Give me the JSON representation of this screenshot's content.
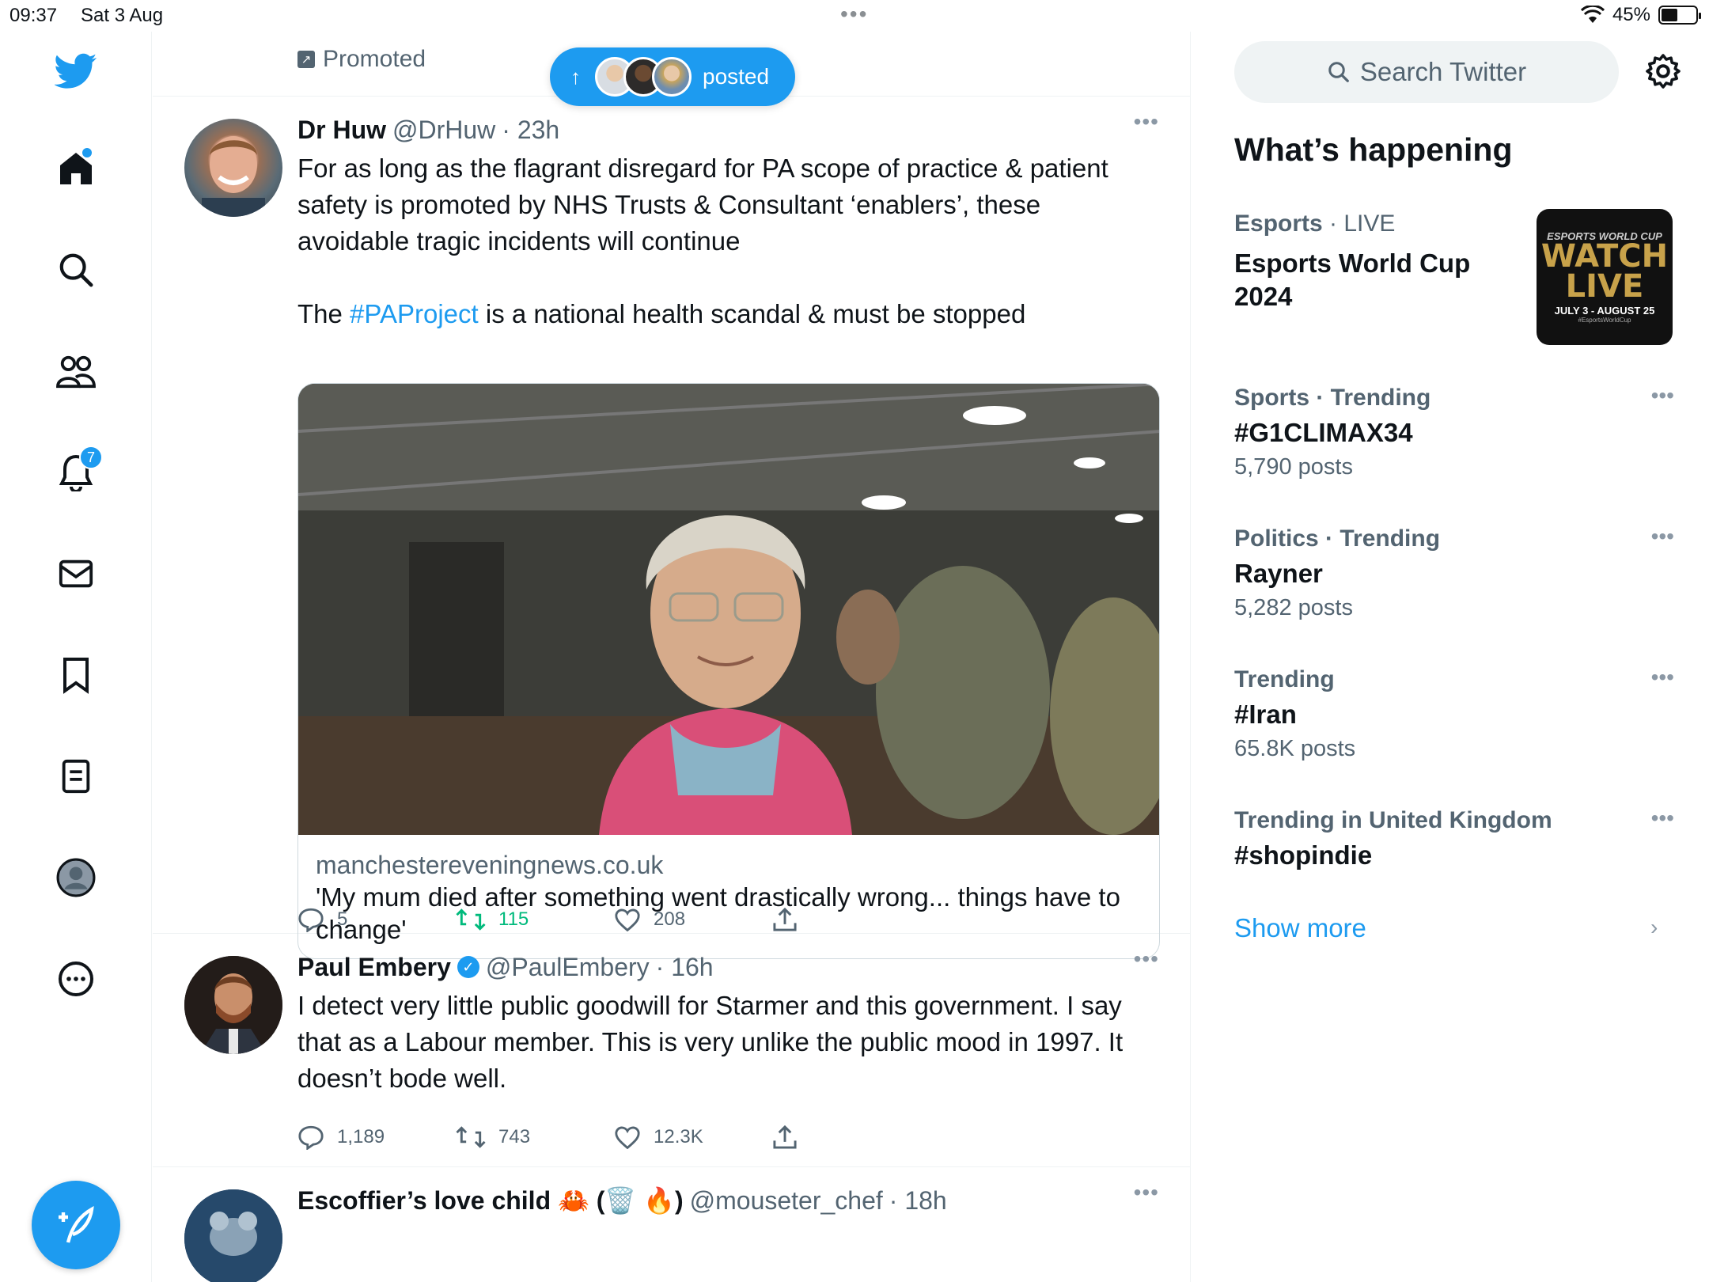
{
  "status_bar": {
    "time": "09:37",
    "date": "Sat 3 Aug",
    "battery": "45%"
  },
  "colors": {
    "accent": "#1d9bf0",
    "retweet": "#00ba7c",
    "secondary_text": "#536471"
  },
  "nav": {
    "items": [
      {
        "name": "twitter-logo-icon"
      },
      {
        "name": "home-icon"
      },
      {
        "name": "explore-icon"
      },
      {
        "name": "communities-icon"
      },
      {
        "name": "notifications-icon",
        "badge": "7"
      },
      {
        "name": "messages-icon"
      },
      {
        "name": "bookmarks-icon"
      },
      {
        "name": "lists-icon"
      },
      {
        "name": "profile-icon"
      },
      {
        "name": "more-icon"
      }
    ],
    "compose": "compose-icon"
  },
  "timeline": {
    "promoted_label": "Promoted",
    "new_posts_pill": {
      "label": "posted"
    },
    "tweets": [
      {
        "name": "Dr Huw",
        "handle": "@DrHuw",
        "time": "· 23h",
        "text1": "For as long as the flagrant disregard for PA scope of practice & patient safety is promoted by NHS Trusts & Consultant ‘enablers’, these avoidable tragic incidents will continue",
        "text2_pre": "The ",
        "text2_tag": "#PAProject",
        "text2_post": " is a national health scandal & must be stopped",
        "card": {
          "domain": "manchestereveningnews.co.uk",
          "title": "'My mum died after something went drastically wrong... things have to change'"
        },
        "replies": "5",
        "retweets": "115",
        "likes": "208"
      },
      {
        "name": "Paul Embery",
        "handle": "@PaulEmbery",
        "time": "· 16h",
        "text": "I detect very little public goodwill for Starmer and this government. I say that as a Labour member. This is very unlike the public mood in 1997. It doesn’t bode well.",
        "replies": "1,189",
        "retweets": "743",
        "likes": "12.3K"
      },
      {
        "name": "Escoffier’s love child 🦀 (🗑️ 🔥)",
        "handle": "@mouseter_chef",
        "time": "· 18h"
      }
    ]
  },
  "sidebar": {
    "search_placeholder": "Search Twitter",
    "title": "What’s happening",
    "trends": [
      {
        "category": "Esports",
        "meta_suffix": " · LIVE",
        "name": "Esports World Cup 2024",
        "count": ""
      },
      {
        "category": "Sports · Trending",
        "meta_suffix": "",
        "name": "#G1CLIMAX34",
        "count": "5,790 posts"
      },
      {
        "category": "Politics · Trending",
        "meta_suffix": "",
        "name": "Rayner",
        "count": "5,282 posts"
      },
      {
        "category": "Trending",
        "meta_suffix": "",
        "name": "#Iran",
        "count": "65.8K posts"
      },
      {
        "category": "Trending in United Kingdom",
        "meta_suffix": "",
        "name": "#shopindie",
        "count": ""
      }
    ],
    "esports_image": {
      "top": "ESPORTS WORLD CUP",
      "watch": "WATCH",
      "live": "LIVE",
      "dates": "JULY 3 - AUGUST 25",
      "tag": "#EsportsWorldCup"
    },
    "show_more": "Show more"
  }
}
